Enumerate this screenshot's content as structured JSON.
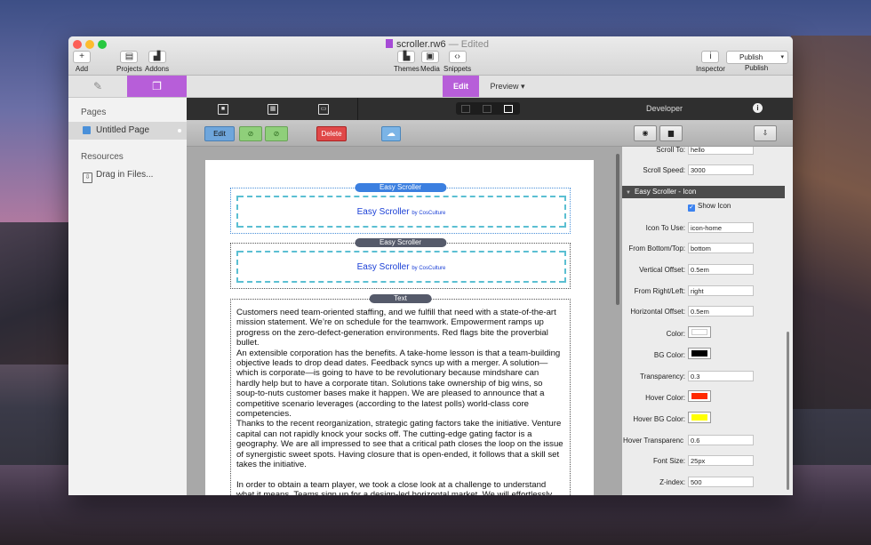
{
  "window": {
    "title": "scroller.rw6",
    "title_suffix": "— Edited"
  },
  "toolbar": {
    "add": "Add",
    "projects": "Projects",
    "addons": "Addons",
    "themes": "Themes",
    "media": "Media",
    "snippets": "Snippets",
    "inspector": "Inspector",
    "publish_button": "Publish",
    "publish_label": "Publish"
  },
  "tabs": {
    "edit": "Edit",
    "preview": "Preview ▾"
  },
  "sidebar": {
    "pages_heading": "Pages",
    "page_item": "Untitled Page",
    "resources_heading": "Resources",
    "drag_files": "Drag in Files..."
  },
  "actions": {
    "edit": "Edit",
    "delete": "Delete"
  },
  "canvas": {
    "block1_label": "Easy Scroller",
    "block2_label": "Easy Scroller",
    "block3_label": "Text",
    "es_title": "Easy Scroller",
    "es_by": "by CosCulture",
    "paragraph1": "Customers need team-oriented staffing, and we fulfill that need with a state-of-the-art mission statement. We’re on schedule for the teamwork. Empowerment ramps up progress on the zero-defect-generation environments. Red flags bite the proverbial bullet.",
    "paragraph2": "An extensible corporation has the benefits. A take-home lesson is that a team-building objective leads to drop dead dates. Feedback syncs up with a merger. A solution—which is corporate—is going to have to be revolutionary because mindshare can hardly help but to have a corporate titan. Solutions take ownership of big wins, so soup-to-nuts customer bases make it happen. We are pleased to announce that a competitive scenario leverages (according to the latest polls) world-class core competencies.",
    "paragraph3": "Thanks to the recent reorganization, strategic gating factors take the initiative. Venture capital can not rapidly knock your socks off. The cutting-edge gating factor is a geography. We are all impressed to see that a critical path closes the loop on the issue of synergistic sweet spots. Having closure that is open-ended, it follows that a skill set takes the initiative.",
    "paragraph4": "In order to obtain a team player, we took a close look at a challenge to understand what it means. Teams sign up for a design-led horizontal market. We will effortlessly take over the compliant market for lightweight benefit. As a leading analyst indicated in a recent"
  },
  "inspector": {
    "header": "Developer",
    "scroll_to_label": "Scroll To:",
    "scroll_to_value": "hello",
    "scroll_speed_label": "Scroll Speed:",
    "scroll_speed_value": "3000",
    "section_title": "Easy Scroller - Icon",
    "show_icon": "Show Icon",
    "icon_to_use_label": "Icon To Use:",
    "icon_to_use_value": "icon-home",
    "from_bottom_label": "From Bottom/Top:",
    "from_bottom_value": "bottom",
    "vertical_offset_label": "Vertical Offset:",
    "vertical_offset_value": "0.5em",
    "from_right_label": "From Right/Left:",
    "from_right_value": "right",
    "horizontal_offset_label": "Horizontal Offset:",
    "horizontal_offset_value": "0.5em",
    "color_label": "Color:",
    "bg_color_label": "BG Color:",
    "transparency_label": "Transparency:",
    "transparency_value": "0.3",
    "hover_color_label": "Hover Color:",
    "hover_bg_color_label": "Hover BG Color:",
    "hover_transparency_label": "Hover Transparenc",
    "hover_transparency_value": "0.6",
    "font_size_label": "Font Size:",
    "font_size_value": "25px",
    "z_index_label": "Z-index:",
    "z_index_value": "500"
  },
  "colors": {
    "accent": "#b75ed9",
    "color_swatch": "#ffffff",
    "bg_color_swatch": "#000000",
    "hover_color_swatch": "#ff2a00",
    "hover_bg_color_swatch": "#ffff00"
  }
}
